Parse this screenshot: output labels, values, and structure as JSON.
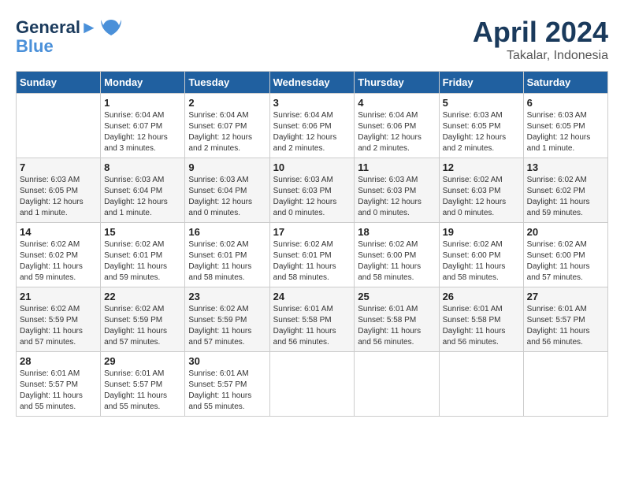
{
  "header": {
    "logo_line1": "General",
    "logo_line2": "Blue",
    "month": "April 2024",
    "location": "Takalar, Indonesia"
  },
  "weekdays": [
    "Sunday",
    "Monday",
    "Tuesday",
    "Wednesday",
    "Thursday",
    "Friday",
    "Saturday"
  ],
  "weeks": [
    [
      {
        "day": "",
        "sunrise": "",
        "sunset": "",
        "daylight": ""
      },
      {
        "day": "1",
        "sunrise": "Sunrise: 6:04 AM",
        "sunset": "Sunset: 6:07 PM",
        "daylight": "Daylight: 12 hours and 3 minutes."
      },
      {
        "day": "2",
        "sunrise": "Sunrise: 6:04 AM",
        "sunset": "Sunset: 6:07 PM",
        "daylight": "Daylight: 12 hours and 2 minutes."
      },
      {
        "day": "3",
        "sunrise": "Sunrise: 6:04 AM",
        "sunset": "Sunset: 6:06 PM",
        "daylight": "Daylight: 12 hours and 2 minutes."
      },
      {
        "day": "4",
        "sunrise": "Sunrise: 6:04 AM",
        "sunset": "Sunset: 6:06 PM",
        "daylight": "Daylight: 12 hours and 2 minutes."
      },
      {
        "day": "5",
        "sunrise": "Sunrise: 6:03 AM",
        "sunset": "Sunset: 6:05 PM",
        "daylight": "Daylight: 12 hours and 2 minutes."
      },
      {
        "day": "6",
        "sunrise": "Sunrise: 6:03 AM",
        "sunset": "Sunset: 6:05 PM",
        "daylight": "Daylight: 12 hours and 1 minute."
      }
    ],
    [
      {
        "day": "7",
        "sunrise": "Sunrise: 6:03 AM",
        "sunset": "Sunset: 6:05 PM",
        "daylight": "Daylight: 12 hours and 1 minute."
      },
      {
        "day": "8",
        "sunrise": "Sunrise: 6:03 AM",
        "sunset": "Sunset: 6:04 PM",
        "daylight": "Daylight: 12 hours and 1 minute."
      },
      {
        "day": "9",
        "sunrise": "Sunrise: 6:03 AM",
        "sunset": "Sunset: 6:04 PM",
        "daylight": "Daylight: 12 hours and 0 minutes."
      },
      {
        "day": "10",
        "sunrise": "Sunrise: 6:03 AM",
        "sunset": "Sunset: 6:03 PM",
        "daylight": "Daylight: 12 hours and 0 minutes."
      },
      {
        "day": "11",
        "sunrise": "Sunrise: 6:03 AM",
        "sunset": "Sunset: 6:03 PM",
        "daylight": "Daylight: 12 hours and 0 minutes."
      },
      {
        "day": "12",
        "sunrise": "Sunrise: 6:02 AM",
        "sunset": "Sunset: 6:03 PM",
        "daylight": "Daylight: 12 hours and 0 minutes."
      },
      {
        "day": "13",
        "sunrise": "Sunrise: 6:02 AM",
        "sunset": "Sunset: 6:02 PM",
        "daylight": "Daylight: 11 hours and 59 minutes."
      }
    ],
    [
      {
        "day": "14",
        "sunrise": "Sunrise: 6:02 AM",
        "sunset": "Sunset: 6:02 PM",
        "daylight": "Daylight: 11 hours and 59 minutes."
      },
      {
        "day": "15",
        "sunrise": "Sunrise: 6:02 AM",
        "sunset": "Sunset: 6:01 PM",
        "daylight": "Daylight: 11 hours and 59 minutes."
      },
      {
        "day": "16",
        "sunrise": "Sunrise: 6:02 AM",
        "sunset": "Sunset: 6:01 PM",
        "daylight": "Daylight: 11 hours and 58 minutes."
      },
      {
        "day": "17",
        "sunrise": "Sunrise: 6:02 AM",
        "sunset": "Sunset: 6:01 PM",
        "daylight": "Daylight: 11 hours and 58 minutes."
      },
      {
        "day": "18",
        "sunrise": "Sunrise: 6:02 AM",
        "sunset": "Sunset: 6:00 PM",
        "daylight": "Daylight: 11 hours and 58 minutes."
      },
      {
        "day": "19",
        "sunrise": "Sunrise: 6:02 AM",
        "sunset": "Sunset: 6:00 PM",
        "daylight": "Daylight: 11 hours and 58 minutes."
      },
      {
        "day": "20",
        "sunrise": "Sunrise: 6:02 AM",
        "sunset": "Sunset: 6:00 PM",
        "daylight": "Daylight: 11 hours and 57 minutes."
      }
    ],
    [
      {
        "day": "21",
        "sunrise": "Sunrise: 6:02 AM",
        "sunset": "Sunset: 5:59 PM",
        "daylight": "Daylight: 11 hours and 57 minutes."
      },
      {
        "day": "22",
        "sunrise": "Sunrise: 6:02 AM",
        "sunset": "Sunset: 5:59 PM",
        "daylight": "Daylight: 11 hours and 57 minutes."
      },
      {
        "day": "23",
        "sunrise": "Sunrise: 6:02 AM",
        "sunset": "Sunset: 5:59 PM",
        "daylight": "Daylight: 11 hours and 57 minutes."
      },
      {
        "day": "24",
        "sunrise": "Sunrise: 6:01 AM",
        "sunset": "Sunset: 5:58 PM",
        "daylight": "Daylight: 11 hours and 56 minutes."
      },
      {
        "day": "25",
        "sunrise": "Sunrise: 6:01 AM",
        "sunset": "Sunset: 5:58 PM",
        "daylight": "Daylight: 11 hours and 56 minutes."
      },
      {
        "day": "26",
        "sunrise": "Sunrise: 6:01 AM",
        "sunset": "Sunset: 5:58 PM",
        "daylight": "Daylight: 11 hours and 56 minutes."
      },
      {
        "day": "27",
        "sunrise": "Sunrise: 6:01 AM",
        "sunset": "Sunset: 5:57 PM",
        "daylight": "Daylight: 11 hours and 56 minutes."
      }
    ],
    [
      {
        "day": "28",
        "sunrise": "Sunrise: 6:01 AM",
        "sunset": "Sunset: 5:57 PM",
        "daylight": "Daylight: 11 hours and 55 minutes."
      },
      {
        "day": "29",
        "sunrise": "Sunrise: 6:01 AM",
        "sunset": "Sunset: 5:57 PM",
        "daylight": "Daylight: 11 hours and 55 minutes."
      },
      {
        "day": "30",
        "sunrise": "Sunrise: 6:01 AM",
        "sunset": "Sunset: 5:57 PM",
        "daylight": "Daylight: 11 hours and 55 minutes."
      },
      {
        "day": "",
        "sunrise": "",
        "sunset": "",
        "daylight": ""
      },
      {
        "day": "",
        "sunrise": "",
        "sunset": "",
        "daylight": ""
      },
      {
        "day": "",
        "sunrise": "",
        "sunset": "",
        "daylight": ""
      },
      {
        "day": "",
        "sunrise": "",
        "sunset": "",
        "daylight": ""
      }
    ]
  ]
}
